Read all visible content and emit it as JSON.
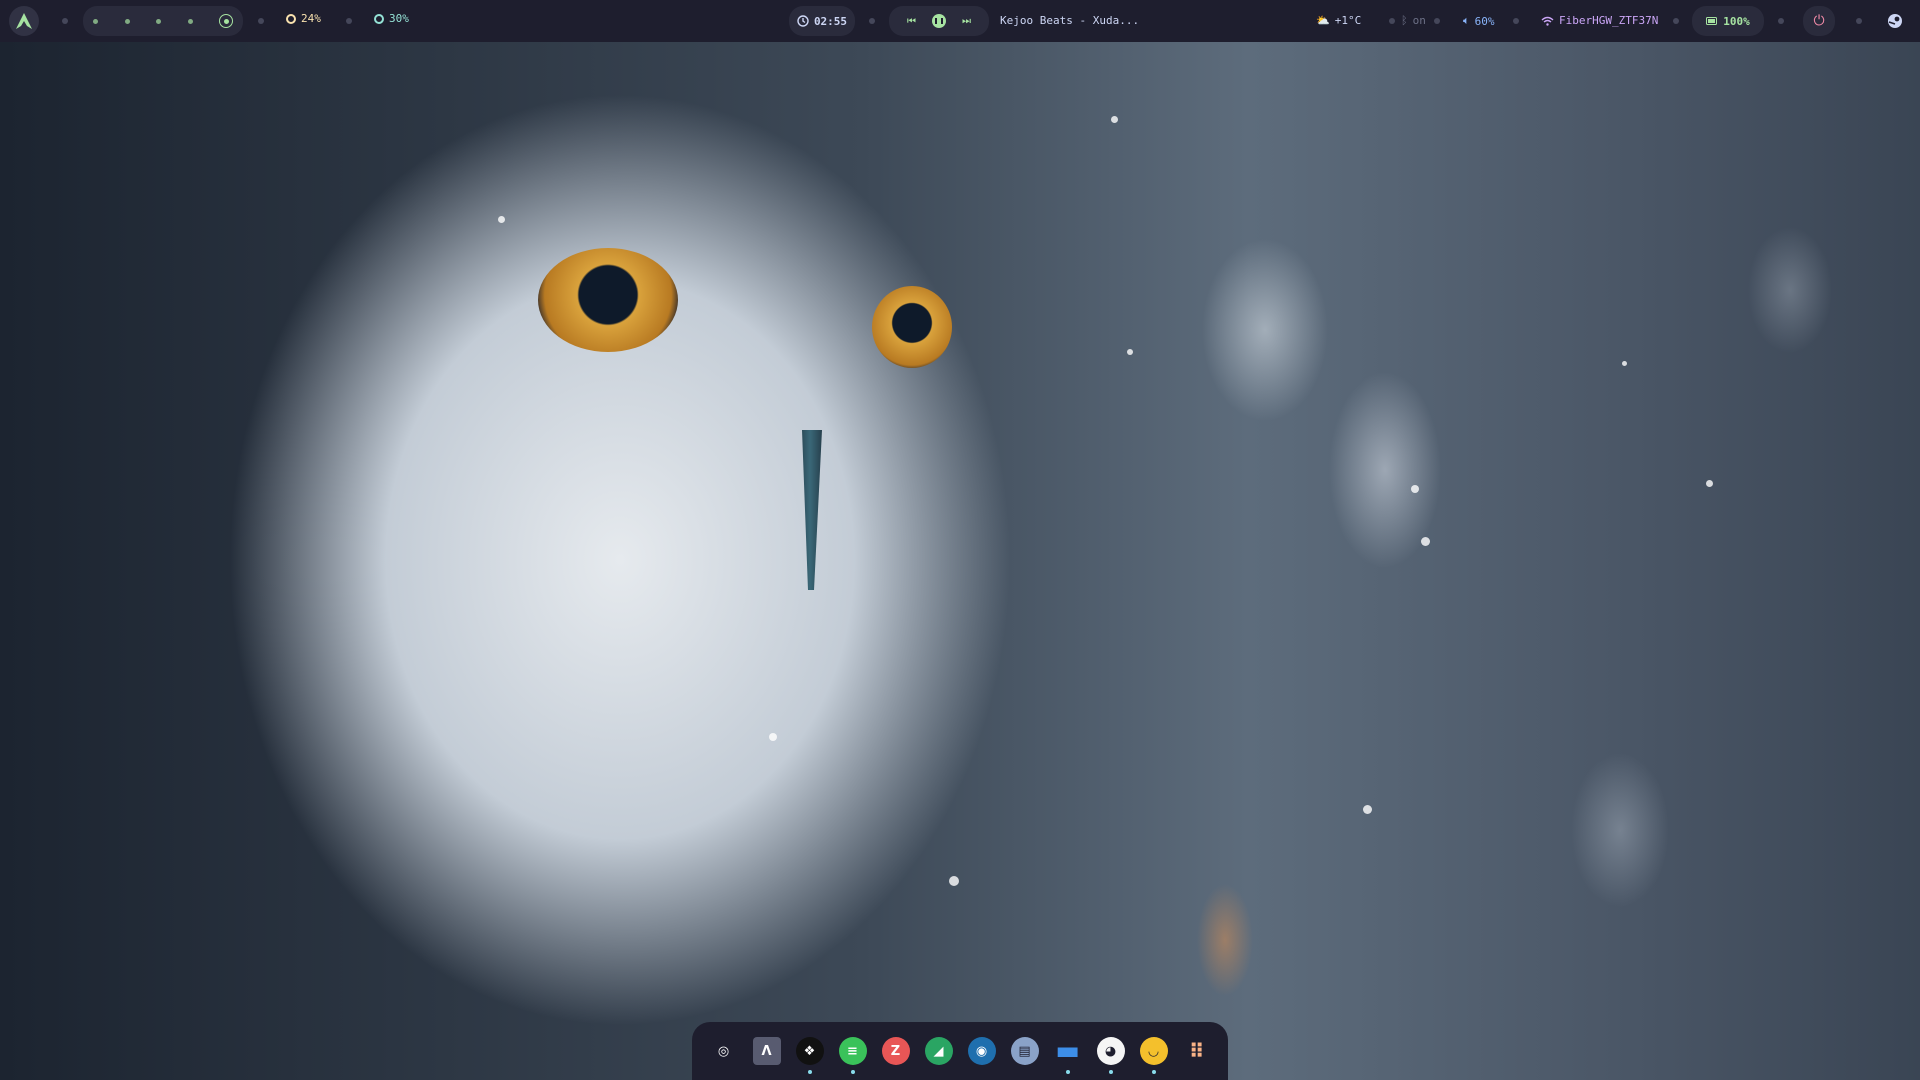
{
  "topbar": {
    "logo": "arch-logo-icon",
    "workspaces": {
      "count": 5,
      "active_index": 4
    },
    "cpu": {
      "icon": "cpu-icon",
      "value": "24%",
      "color": "#f9e2af"
    },
    "memory": {
      "icon": "memory-icon",
      "value": "30%",
      "color": "#94e2d5"
    },
    "clock": {
      "icon": "clock-icon",
      "time": "02:55"
    },
    "media": {
      "prev_icon": "skip-previous-icon",
      "play_icon": "pause-icon",
      "next_icon": "skip-next-icon",
      "track": "Kejoo Beats - Xuda..."
    },
    "weather": {
      "icon": "partly-cloudy-icon",
      "value": "+1°C"
    },
    "bluetooth": {
      "icon": "bluetooth-icon",
      "value": "on"
    },
    "volume": {
      "icon": "volume-icon",
      "value": "60%",
      "color": "#89b4fa"
    },
    "wifi": {
      "icon": "wifi-icon",
      "value": "FiberHGW_ZTF37N",
      "color": "#cba6f7"
    },
    "battery": {
      "icon": "battery-icon",
      "value": "100%",
      "color": "#a6e3a1"
    },
    "power": {
      "icon": "power-icon",
      "color": "#f38ba8"
    },
    "tray": {
      "icon": "steam-tray-icon"
    }
  },
  "dock": {
    "items": [
      {
        "name": "settings-rings-icon",
        "glyph": "◎",
        "bg": "#1e1e2e",
        "running": false
      },
      {
        "name": "arch-terminal-icon",
        "glyph": "Λ",
        "bg": "#585b70",
        "running": false
      },
      {
        "name": "dropbox-icon",
        "glyph": "❖",
        "bg": "#111111",
        "running": true
      },
      {
        "name": "spotify-icon",
        "glyph": "≡",
        "bg": "#3ac25a",
        "running": true
      },
      {
        "name": "filezilla-icon",
        "glyph": "Z",
        "bg": "#e85656",
        "running": false
      },
      {
        "name": "android-studio-icon",
        "glyph": "◢",
        "bg": "#2aa563",
        "running": false
      },
      {
        "name": "steam-icon",
        "glyph": "◉",
        "bg": "#1f6fae",
        "running": false
      },
      {
        "name": "text-editor-icon",
        "glyph": "▤",
        "bg": "#8aa2c8",
        "running": false
      },
      {
        "name": "files-folder-icon",
        "glyph": "▬",
        "bg": "#3d8ee8",
        "running": true
      },
      {
        "name": "github-icon",
        "glyph": "◕",
        "bg": "#f5f5f5",
        "running": true
      },
      {
        "name": "ollama-icon",
        "glyph": "◡",
        "bg": "#f4c02c",
        "running": true
      },
      {
        "name": "app-grid-icon",
        "glyph": "⠿",
        "bg": "#1e1e2e",
        "running": false
      }
    ]
  }
}
